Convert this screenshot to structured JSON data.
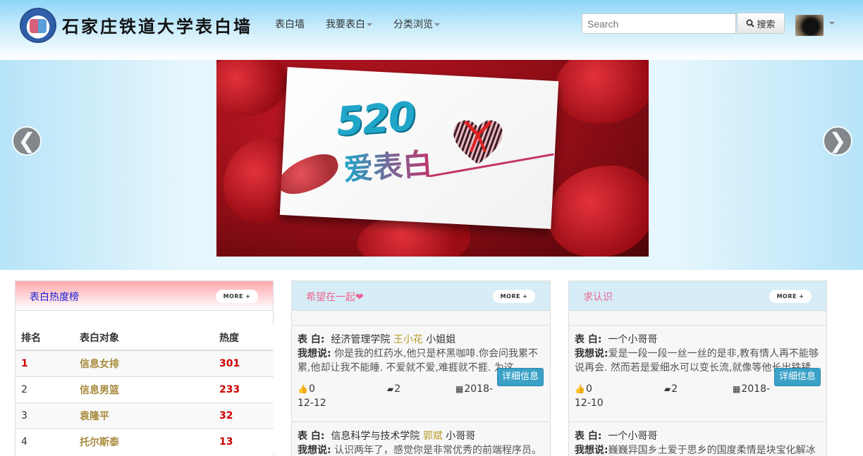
{
  "brand": {
    "logo": "school-logo-icon",
    "title": "石家庄铁道大学表白墙"
  },
  "nav": {
    "items": [
      {
        "label": "表白墙",
        "dropdown": false
      },
      {
        "label": "我要表白",
        "dropdown": true
      },
      {
        "label": "分类浏览",
        "dropdown": true
      }
    ]
  },
  "search": {
    "placeholder": "Search",
    "button_label": "搜索",
    "button_icon": "search-icon"
  },
  "user": {
    "avatar": "user-avatar",
    "menu_icon": "caret-down-icon"
  },
  "carousel": {
    "prev_label": "❮",
    "next_label": "❯",
    "banner": {
      "number": "520",
      "slogan": "爱表白"
    }
  },
  "colors": {
    "accent": "#3ba1c7",
    "highlight_name": "#b99a2a",
    "rank_target": "#a78a3c",
    "heat": "#cc0000"
  },
  "panels": [
    {
      "title": "表白热度榜",
      "more": "MORE +",
      "table": {
        "headers": [
          "排名",
          "表白对象",
          "热度"
        ],
        "rows": [
          {
            "rank": "1",
            "target": "信息女排",
            "heat": "301"
          },
          {
            "rank": "2",
            "target": "信息男篮",
            "heat": "233"
          },
          {
            "rank": "3",
            "target": "袁隆平",
            "heat": "32"
          },
          {
            "rank": "4",
            "target": "托尔斯泰",
            "heat": "13"
          }
        ]
      }
    },
    {
      "title": "希望在一起❤",
      "more": "MORE +",
      "posts": [
        {
          "to_label": "表 白:",
          "to_prefix": "经济管理学院",
          "to_name": "王小花",
          "to_suffix": "小姐姐",
          "says_label": "我想说:",
          "content": "你是我的红药水,他只是杯黑咖啡.你会问我累不累,他却让我不能睡. 不爱就不爱,难捱就不捱. 为这",
          "detail": "详细信息",
          "likes": "0",
          "comments": "2",
          "date_a": "2018-",
          "date_b": "12-12"
        },
        {
          "to_label": "表 白:",
          "to_prefix": "信息科学与技术学院",
          "to_name": "郭斌",
          "to_suffix": "小哥哥",
          "says_label": "我想说:",
          "content": "认识两年了，感觉你是非常优秀的前端程序员。"
        }
      ]
    },
    {
      "title": "求认识",
      "more": "MORE +",
      "posts": [
        {
          "to_label": "表 白:",
          "to_prefix": "一个小哥哥",
          "to_name": "",
          "to_suffix": "",
          "says_label": "我想说:",
          "content": "爱是一段一段一丝一丝的是非,教有情人再不能够说再会. 然而若是爱细水可以变长流,就像等他长出铁锈",
          "detail": "详细信息",
          "likes": "0",
          "comments": "2",
          "date_a": "2018-",
          "date_b": "12-10"
        },
        {
          "to_label": "表 白:",
          "to_prefix": "一个小哥哥",
          "to_name": "",
          "to_suffix": "",
          "says_label": "我想说:",
          "content": "巍巍异国乡土爱于思乡的国度柔情是块宝化解冰"
        }
      ]
    }
  ]
}
